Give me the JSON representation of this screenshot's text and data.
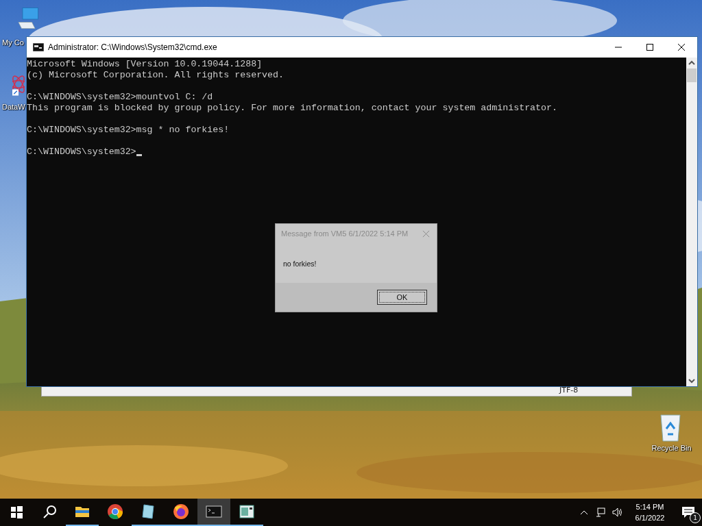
{
  "desktop_icons": [
    {
      "kind": "computer",
      "label": "My Co"
    },
    {
      "kind": "app",
      "label": "DataW"
    },
    {
      "kind": "recycle",
      "label": "Recycle Bin"
    }
  ],
  "background_window": {
    "status_text": "JTF-8"
  },
  "console_window": {
    "title": "Administrator: C:\\Windows\\System32\\cmd.exe",
    "blocks": [
      [
        "Microsoft Windows [Version 10.0.19044.1288]",
        "(c) Microsoft Corporation. All rights reserved."
      ],
      [
        "C:\\WINDOWS\\system32>mountvol C: /d",
        "This program is blocked by group policy. For more information, contact your system administrator."
      ],
      [
        "C:\\WINDOWS\\system32>msg * no forkies!"
      ],
      [
        "C:\\WINDOWS\\system32>"
      ]
    ],
    "cursor": true
  },
  "message_dialog": {
    "title": "Message from VM5 6/1/2022 5:14 PM",
    "message": "no forkies!",
    "button": "OK"
  },
  "taskbar": {
    "apps": [
      {
        "kind": "explorer",
        "running": true,
        "selected": false
      },
      {
        "kind": "chrome",
        "running": false,
        "selected": false
      },
      {
        "kind": "notes",
        "running": true,
        "selected": false
      },
      {
        "kind": "firefox",
        "running": true,
        "selected": false
      },
      {
        "kind": "terminal",
        "running": true,
        "selected": true
      },
      {
        "kind": "document",
        "running": true,
        "selected": false
      }
    ],
    "time": "5:14 PM",
    "date": "6/1/2022",
    "notifications": "1"
  }
}
